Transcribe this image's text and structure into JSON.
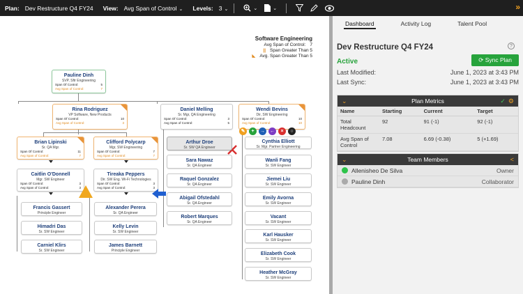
{
  "toolbar": {
    "plan_label": "Plan:",
    "plan_value": "Dev Restructure Q4 FY24",
    "view_label": "View:",
    "view_value": "Avg Span of Control",
    "levels_label": "Levels:",
    "levels_value": "3"
  },
  "legend": {
    "title": "Software Engineering",
    "rows": [
      {
        "label": "Avg Span of Control:",
        "value": "7"
      },
      {
        "label": "Span Greater Than 5",
        "marker": "||"
      },
      {
        "label": "Avg. Span Greater Than 5",
        "marker": "◣"
      }
    ]
  },
  "org": {
    "span_label": "Span Of Control:",
    "avg_label": "Avg Span of Control:",
    "root": {
      "name": "Pauline Dinh",
      "title": "SVP, Sftr Engineering",
      "span": "5",
      "avg": "7"
    },
    "l1": [
      {
        "name": "Rina Rodriguez",
        "title": "VP Software, New Products",
        "span": "10",
        "avg": "3"
      },
      {
        "name": "Daniel Melling",
        "title": "Sr. Mgr, QA Engineering",
        "span": "3",
        "avg": "5"
      },
      {
        "name": "Wendi Bevins",
        "title": "Dir, SW Engineering",
        "span": "10",
        "avg": "10"
      }
    ],
    "l2": [
      {
        "name": "Brian Lipinski",
        "title": "Sr. QA Mgr.",
        "span": "11",
        "avg": "7"
      },
      {
        "name": "Clifford Polycarp",
        "title": "Mgr, SW Engineering",
        "span": "7",
        "avg": "7"
      }
    ],
    "l3": [
      {
        "name": "Caitlin O'Donnell",
        "title": "Mgr. SW Engineer",
        "span": "3",
        "avg": "3"
      },
      {
        "name": "Tireaka Peppers",
        "title": "Dir. SW Eng. Wi-Fi Technologies",
        "span": "3",
        "avg": "3"
      }
    ],
    "col1": [
      {
        "name": "Francis Gassert",
        "title": "Principle Engineer"
      },
      {
        "name": "Himadri Das",
        "title": "Sr. SW Engineer"
      },
      {
        "name": "Carniel Klirs",
        "title": "Sr. SW Engineer"
      }
    ],
    "col2": [
      {
        "name": "Alexander Perera",
        "title": "Sr. QA Engineer"
      },
      {
        "name": "Kelly Levin",
        "title": "Sr. SW Engineer"
      },
      {
        "name": "James Barnett",
        "title": "Principle Engineer"
      }
    ],
    "col3": [
      {
        "name": "Arthur Droe",
        "title": "Sr. SW QA Engineer"
      },
      {
        "name": "Sara Nawaz",
        "title": "Sr. QA Engineer"
      },
      {
        "name": "Raquel Gonzalez",
        "title": "Sr. QA Engineer"
      },
      {
        "name": "Abigail Ofstedahl",
        "title": "Sr. QA Engineer"
      },
      {
        "name": "Robert Marques",
        "title": "Sr. QA Engineer"
      }
    ],
    "col4": [
      {
        "name": "Cynthia Elliott",
        "title": "Sr. Mgr. Partner Engineering"
      },
      {
        "name": "Wanli Fang",
        "title": "Sr. SW Engineer"
      },
      {
        "name": "Jiemei Liu",
        "title": "Sr. SW Engineer"
      },
      {
        "name": "Emily Avorna",
        "title": "Sr. SW Engineer"
      },
      {
        "name": "Vacant",
        "title": "Sr. SW Engineer"
      },
      {
        "name": "Karl Hausker",
        "title": "Sr. SW Engineer"
      },
      {
        "name": "Elizabeth Cook",
        "title": "Sr. SW Engineer"
      },
      {
        "name": "Heather McGray",
        "title": "Sr. SW Engineer"
      }
    ]
  },
  "panel": {
    "tabs": [
      "Dashboard",
      "Activity Log",
      "Talent Pool"
    ],
    "plan_title": "Dev Restructure Q4 FY24",
    "help": "?",
    "status": "Active",
    "sync_label": "Sync Plan",
    "last_modified_label": "Last Modified:",
    "last_modified_value": "June 1, 2023 at 3:43 PM",
    "last_sync_label": "Last Sync:",
    "last_sync_value": "June 1, 2023 at 3:43 PM",
    "metrics": {
      "title": "Plan Metrics",
      "headers": [
        "Name",
        "Starting",
        "Current",
        "Target"
      ],
      "rows": [
        {
          "name": "Total Headcount",
          "starting": "92",
          "current": "91 (-1)",
          "target": "92 (-1)"
        },
        {
          "name": "Avg Span of Control",
          "starting": "7.08",
          "current": "6.69 (-0.38)",
          "target": "5 (+1.69)"
        }
      ]
    },
    "team": {
      "title": "Team Members",
      "members": [
        {
          "name": "Allenisheo De Silva",
          "role": "Owner",
          "color": "#2ec44a"
        },
        {
          "name": "Pauline Dinh",
          "role": "Collaborator",
          "color": "#aaaaaa"
        }
      ]
    }
  },
  "colors": {
    "accent": "#f0a020",
    "brand_dark": "#1f1f1f",
    "positive": "#28a33c",
    "negative": "#d93030",
    "name_blue": "#1e3f7a"
  }
}
